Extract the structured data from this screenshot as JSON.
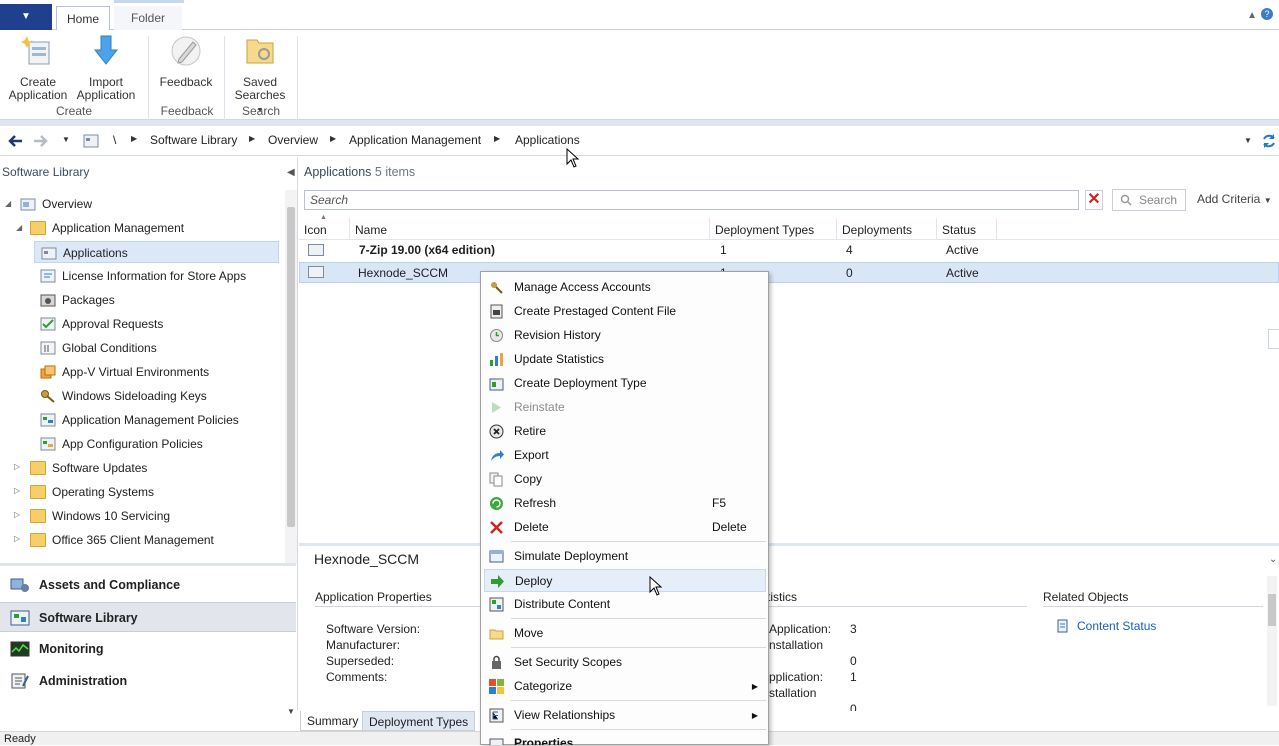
{
  "ribbon": {
    "tabs": [
      "Home",
      "Folder"
    ],
    "buttons": {
      "create_application": "Create Application",
      "import_application": "Import Application",
      "feedback": "Feedback",
      "saved_searches": "Saved Searches"
    },
    "groups": [
      "Create",
      "Feedback",
      "Search"
    ]
  },
  "breadcrumb": [
    "\\",
    "Software Library",
    "Overview",
    "Application Management",
    "Applications"
  ],
  "left_pane": {
    "title": "Software Library",
    "tree": [
      "Overview",
      "Application Management",
      "Applications",
      "License Information for Store Apps",
      "Packages",
      "Approval Requests",
      "Global Conditions",
      "App-V Virtual Environments",
      "Windows Sideloading Keys",
      "Application Management Policies",
      "App Configuration Policies",
      "Software Updates",
      "Operating Systems",
      "Windows 10 Servicing",
      "Office 365 Client Management"
    ],
    "workspaces": [
      "Assets and Compliance",
      "Software Library",
      "Monitoring",
      "Administration"
    ]
  },
  "main": {
    "title": "Applications",
    "count": "5 items",
    "search_placeholder": "Search",
    "search_button": "Search",
    "add_criteria": "Add Criteria",
    "columns": [
      "Icon",
      "Name",
      "Deployment Types",
      "Deployments",
      "Status"
    ],
    "rows": [
      {
        "name": "7-Zip 19.00 (x64 edition)",
        "deployment_types": "1",
        "deployments": "4",
        "status": "Active"
      },
      {
        "name": "Hexnode_SCCM",
        "deployment_types": "1",
        "deployments": "0",
        "status": "Active"
      }
    ]
  },
  "details": {
    "title": "Hexnode_SCCM",
    "sections": [
      "Application Properties",
      "tistics",
      "Related Objects"
    ],
    "props": [
      "Software Version:",
      "Manufacturer:",
      "Superseded:",
      "Comments:"
    ],
    "stats": [
      {
        "label": "Application:",
        "value": "3"
      },
      {
        "label": "nstallation",
        "value": ""
      },
      {
        "label": "",
        "value": "0"
      },
      {
        "label": "pplication:",
        "value": "1"
      },
      {
        "label": "stallation",
        "value": ""
      },
      {
        "label": "",
        "value": "0"
      }
    ],
    "related_link": "Content Status",
    "tabs": [
      "Summary",
      "Deployment Types"
    ]
  },
  "status_bar": "Ready",
  "context_menu": {
    "items": [
      {
        "label": "Manage Access Accounts",
        "shortcut": ""
      },
      {
        "label": "Create Prestaged Content File",
        "shortcut": ""
      },
      {
        "label": "Revision History",
        "shortcut": ""
      },
      {
        "label": "Update Statistics",
        "shortcut": ""
      },
      {
        "label": "Create Deployment Type",
        "shortcut": ""
      },
      {
        "label": "Reinstate",
        "shortcut": ""
      },
      {
        "label": "Retire",
        "shortcut": ""
      },
      {
        "label": "Export",
        "shortcut": ""
      },
      {
        "label": "Copy",
        "shortcut": ""
      },
      {
        "label": "Refresh",
        "shortcut": "F5"
      },
      {
        "label": "Delete",
        "shortcut": "Delete"
      },
      {
        "label": "Simulate Deployment",
        "shortcut": ""
      },
      {
        "label": "Deploy",
        "shortcut": ""
      },
      {
        "label": "Distribute Content",
        "shortcut": ""
      },
      {
        "label": "Move",
        "shortcut": ""
      },
      {
        "label": "Set Security Scopes",
        "shortcut": ""
      },
      {
        "label": "Categorize",
        "shortcut": ""
      },
      {
        "label": "View Relationships",
        "shortcut": ""
      },
      {
        "label": "Properties",
        "shortcut": ""
      }
    ]
  },
  "colors": {
    "accent": "#1f3f8f",
    "selection": "#dce8f7",
    "delete_red": "#d42020",
    "deploy_green": "#2e9e2e"
  }
}
